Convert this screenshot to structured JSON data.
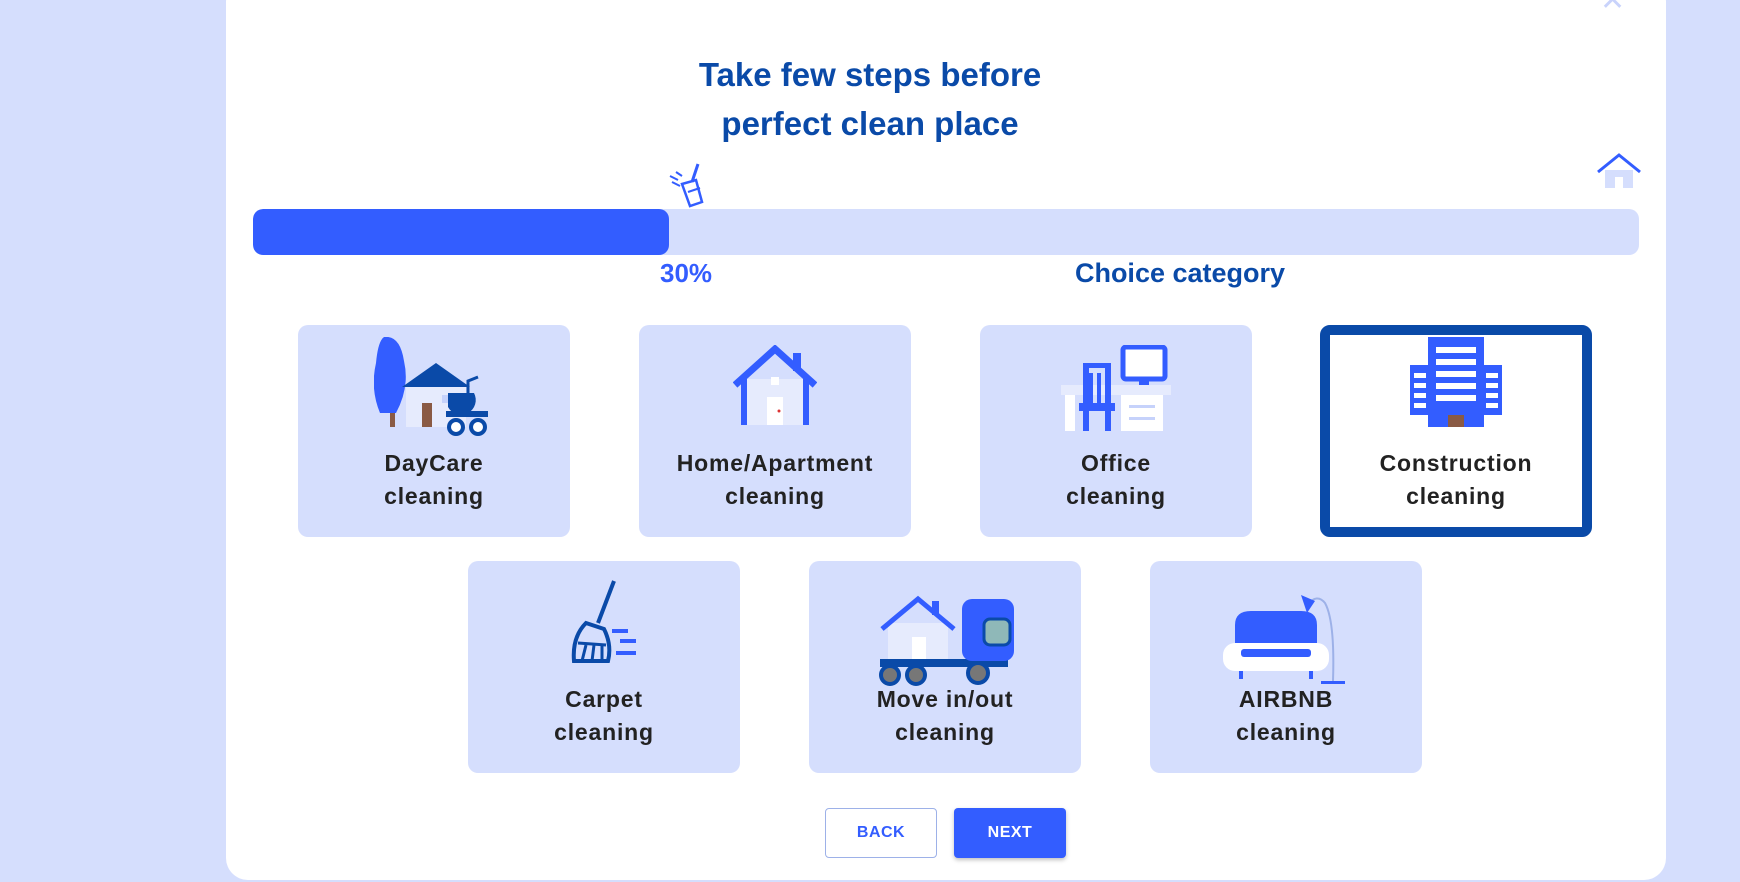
{
  "close_icon": "close-icon",
  "title": {
    "line1": "Take few steps before",
    "line2": "perfect clean place"
  },
  "progress": {
    "percent": 30,
    "percent_label": "30%",
    "step_label": "Choice category",
    "start_icon": "broom-icon",
    "end_icon": "house-icon"
  },
  "categories": [
    {
      "line1": "DayCare",
      "line2": "cleaning",
      "icon": "daycare-icon",
      "selected": false
    },
    {
      "line1": "Home/Apartment",
      "line2": "cleaning",
      "icon": "home-icon",
      "selected": false
    },
    {
      "line1": "Office",
      "line2": "cleaning",
      "icon": "office-icon",
      "selected": false
    },
    {
      "line1": "Construction",
      "line2": "cleaning",
      "icon": "building-icon",
      "selected": true
    },
    {
      "line1": "Carpet",
      "line2": "cleaning",
      "icon": "broom-icon",
      "selected": false
    },
    {
      "line1": "Move in/out",
      "line2": "cleaning",
      "icon": "moving-truck-icon",
      "selected": false
    },
    {
      "line1": "AIRBNB",
      "line2": "cleaning",
      "icon": "sofa-lamp-icon",
      "selected": false
    }
  ],
  "buttons": {
    "back": "BACK",
    "next": "NEXT"
  },
  "colors": {
    "accent": "#335dff",
    "dark": "#0a4aa8",
    "light": "#d5defd"
  }
}
